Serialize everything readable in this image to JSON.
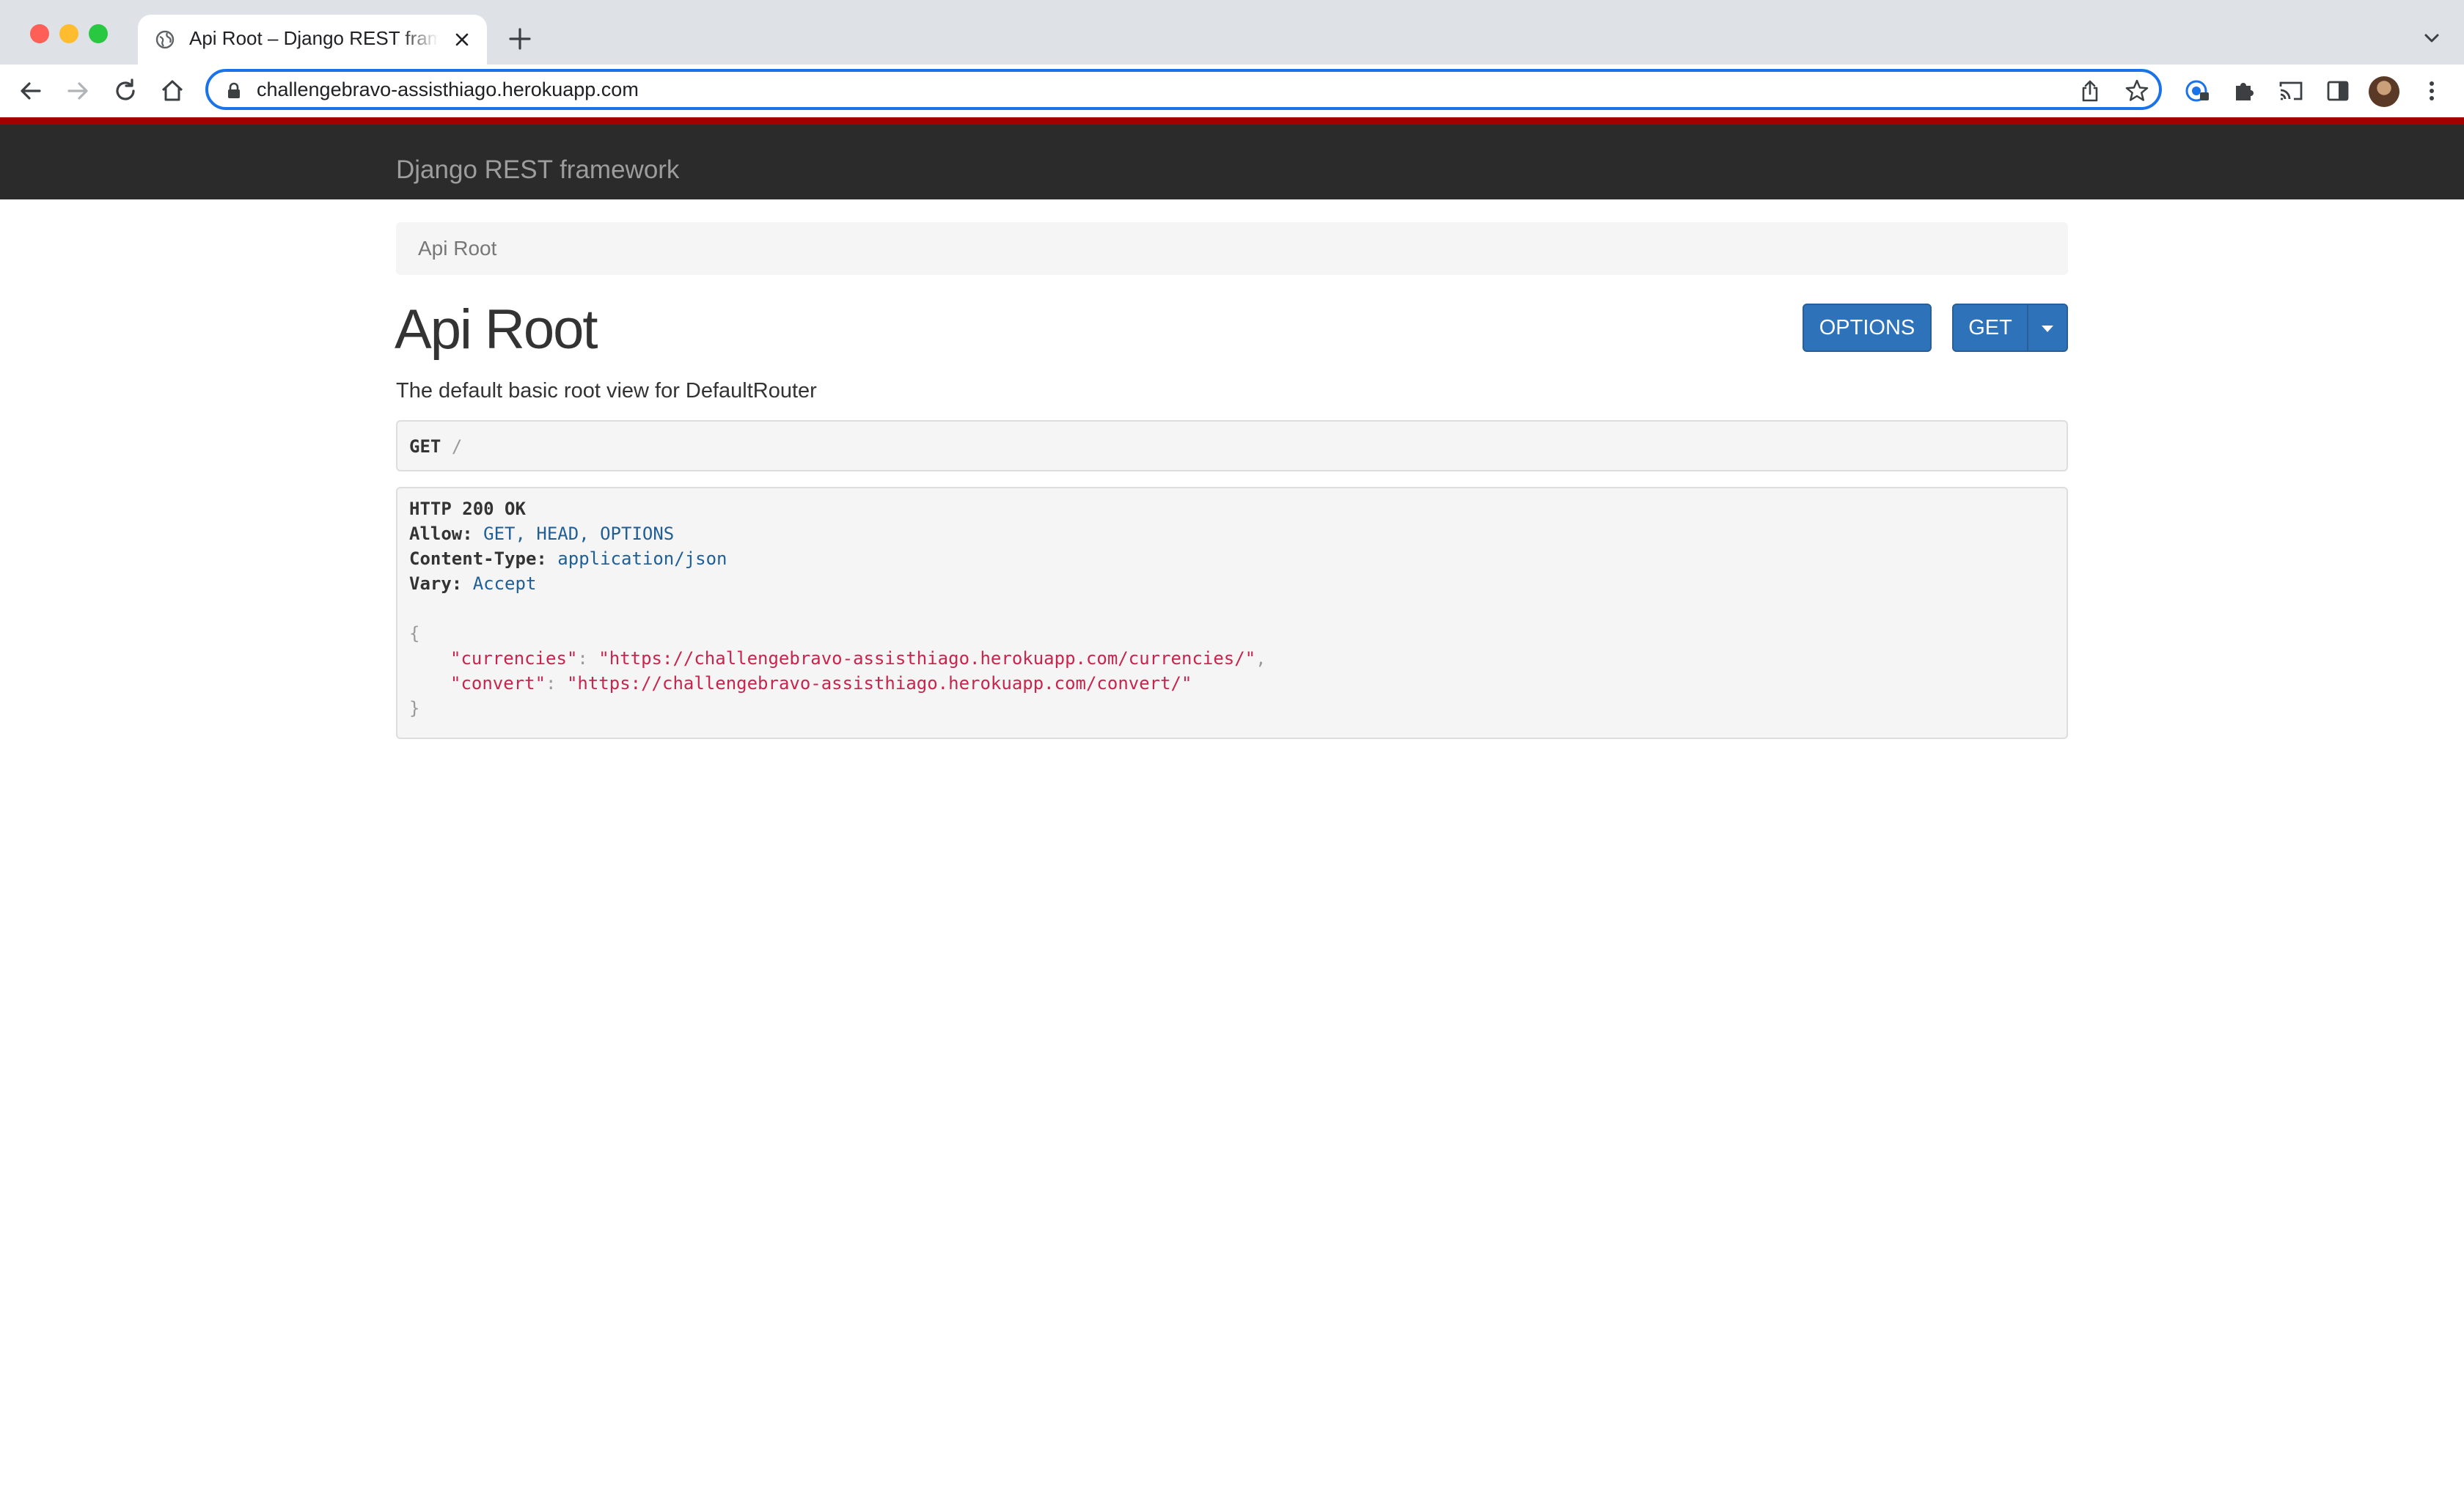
{
  "browser": {
    "tab_title": "Api Root – Django REST framework",
    "url": "challengebravo-assisthiago.herokuapp.com"
  },
  "navbar": {
    "brand": "Django REST framework"
  },
  "breadcrumb": {
    "items": [
      "Api Root"
    ]
  },
  "content": {
    "title": "Api Root",
    "description": "The default basic root view for DefaultRouter",
    "buttons": {
      "options": "OPTIONS",
      "get": "GET"
    },
    "request": {
      "method": "GET",
      "path": "/"
    },
    "response": {
      "status": "HTTP 200 OK",
      "headers": [
        {
          "name": "Allow:",
          "value": "GET, HEAD, OPTIONS"
        },
        {
          "name": "Content-Type:",
          "value": "application/json"
        },
        {
          "name": "Vary:",
          "value": "Accept"
        }
      ],
      "body_open": "{",
      "body_close": "}",
      "fields": [
        {
          "key": "\"currencies\"",
          "value": "\"https://challengebravo-assisthiago.herokuapp.com/currencies/\"",
          "trail": ","
        },
        {
          "key": "\"convert\"",
          "value": "\"https://challengebravo-assisthiago.herokuapp.com/convert/\"",
          "trail": ""
        }
      ]
    }
  },
  "colors": {
    "navbar": "#2b2b2b",
    "navbar_accent": "#a30000",
    "button": "#2e72b9",
    "json_string": "#c7254e",
    "header_value": "#1f5f95"
  }
}
